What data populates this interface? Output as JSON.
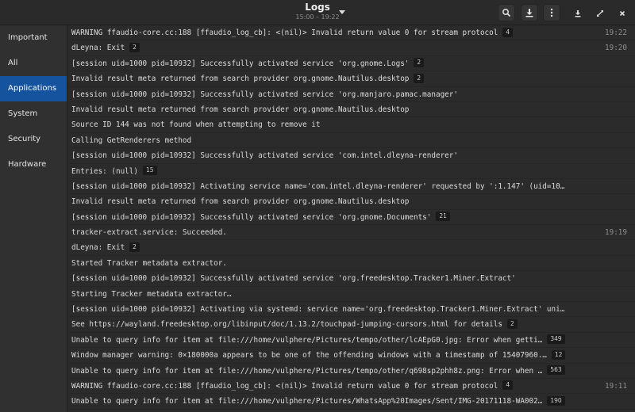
{
  "header": {
    "title": "Logs",
    "subtitle": "15:00 – 19:22",
    "buttons": {
      "search": "search-icon",
      "export": "download-icon",
      "menu": "kebab-menu-icon"
    },
    "window_controls": {
      "minimize": "minimize-icon",
      "maximize": "maximize-icon",
      "close": "close-icon"
    }
  },
  "sidebar": {
    "items": [
      {
        "label": "Important",
        "active": false
      },
      {
        "label": "All",
        "active": false
      },
      {
        "label": "Applications",
        "active": true
      },
      {
        "label": "System",
        "active": false
      },
      {
        "label": "Security",
        "active": false
      },
      {
        "label": "Hardware",
        "active": false
      }
    ]
  },
  "colors": {
    "accent": "#15539e",
    "background": "#2b2b2b",
    "sidebar": "#303030",
    "header": "#2a2a2a",
    "timestamp": "#8e8e8e"
  },
  "logs": [
    {
      "message": "WARNING ffaudio-core.cc:188 [ffaudio_log_cb]: <(nil)> Invalid return value 0 for stream protocol",
      "count": "4",
      "time": "19:22"
    },
    {
      "message": "dLeyna: Exit",
      "count": "2",
      "time": "19:20"
    },
    {
      "message": "[session uid=1000 pid=10932] Successfully activated service 'org.gnome.Logs'",
      "count": "2",
      "time": ""
    },
    {
      "message": "Invalid result meta returned from search provider org.gnome.Nautilus.desktop",
      "count": "2",
      "time": ""
    },
    {
      "message": "[session uid=1000 pid=10932] Successfully activated service 'org.manjaro.pamac.manager'",
      "count": "",
      "time": ""
    },
    {
      "message": "Invalid result meta returned from search provider org.gnome.Nautilus.desktop",
      "count": "",
      "time": ""
    },
    {
      "message": "Source ID 144 was not found when attempting to remove it",
      "count": "",
      "time": ""
    },
    {
      "message": "Calling GetRenderers method",
      "count": "",
      "time": ""
    },
    {
      "message": "[session uid=1000 pid=10932] Successfully activated service 'com.intel.dleyna-renderer'",
      "count": "",
      "time": ""
    },
    {
      "message": "Entries: (null)",
      "count": "15",
      "time": ""
    },
    {
      "message": "[session uid=1000 pid=10932] Activating service name='com.intel.dleyna-renderer' requested by ':1.147' (uid=10…",
      "count": "",
      "time": ""
    },
    {
      "message": "Invalid result meta returned from search provider org.gnome.Nautilus.desktop",
      "count": "",
      "time": ""
    },
    {
      "message": "[session uid=1000 pid=10932] Successfully activated service 'org.gnome.Documents'",
      "count": "21",
      "time": ""
    },
    {
      "message": "tracker-extract.service: Succeeded.",
      "count": "",
      "time": "19:19"
    },
    {
      "message": "dLeyna: Exit",
      "count": "2",
      "time": ""
    },
    {
      "message": "Started Tracker metadata extractor.",
      "count": "",
      "time": ""
    },
    {
      "message": "[session uid=1000 pid=10932] Successfully activated service 'org.freedesktop.Tracker1.Miner.Extract'",
      "count": "",
      "time": ""
    },
    {
      "message": "Starting Tracker metadata extractor…",
      "count": "",
      "time": ""
    },
    {
      "message": "[session uid=1000 pid=10932] Activating via systemd: service name='org.freedesktop.Tracker1.Miner.Extract' uni…",
      "count": "",
      "time": ""
    },
    {
      "message": "See https://wayland.freedesktop.org/libinput/doc/1.13.2/touchpad-jumping-cursors.html for details",
      "count": "2",
      "time": ""
    },
    {
      "message": "Unable to query info for item at file:///home/vulphere/Pictures/tempo/other/lcAEpG0.jpg: Error when getti…",
      "count": "349",
      "time": ""
    },
    {
      "message": "Window manager warning: 0×180000a appears to be one of the offending windows with a timestamp of 15407960.…",
      "count": "12",
      "time": ""
    },
    {
      "message": "Unable to query info for item at file:///home/vulphere/Pictures/tempo/other/q698sp2phh8z.png: Error when …",
      "count": "563",
      "time": ""
    },
    {
      "message": "WARNING ffaudio-core.cc:188 [ffaudio_log_cb]: <(nil)> Invalid return value 0 for stream protocol",
      "count": "4",
      "time": "19:11"
    },
    {
      "message": "Unable to query info for item at file:///home/vulphere/Pictures/WhatsApp%20Images/Sent/IMG-20171118-WA002…",
      "count": "190",
      "time": ""
    }
  ]
}
